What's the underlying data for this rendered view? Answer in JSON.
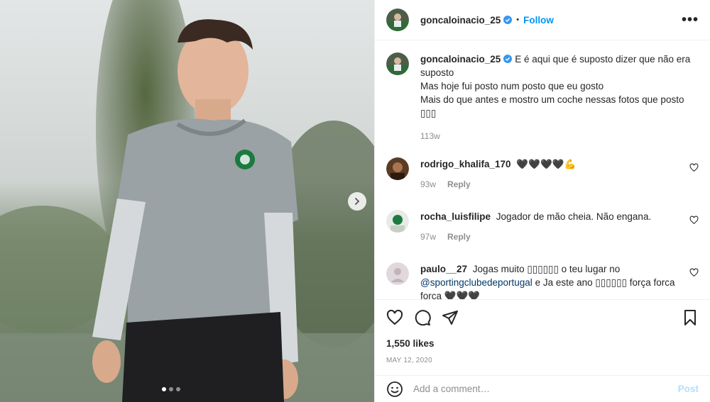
{
  "header": {
    "username": "goncaloinacio_25",
    "separator": "•",
    "follow_label": "Follow",
    "more_label": "•••"
  },
  "caption": {
    "username": "goncaloinacio_25",
    "lines": [
      "E é aqui que é suposto dizer que não era suposto",
      "Mas hoje fui posto num posto que eu gosto",
      "Mais do que antes e mostro um coche nessas fotos que posto",
      "▯▯▯"
    ],
    "time": "113w"
  },
  "comments": [
    {
      "username": "rodrigo_khalifa_170",
      "text": "🖤🖤🖤🖤💪",
      "time": "93w",
      "reply_label": "Reply"
    },
    {
      "username": "rocha_luisfilipe",
      "text": "Jogador de mão cheia. Não engana.",
      "time": "97w",
      "reply_label": "Reply"
    },
    {
      "username": "paulo__27",
      "text_a": "Jogas muito ▯▯▯▯▯▯ o teu lugar no",
      "mention": "@sportingclubedeportugal",
      "text_b": "e Ja este ano ▯▯▯▯▯▯ força forca forca 🖤🖤🖤"
    }
  ],
  "likes": "1,550 likes",
  "date": "MAY 12, 2020",
  "add_comment": {
    "placeholder": "Add a comment…",
    "post_label": "Post"
  },
  "carousel": {
    "count": 3,
    "active": 1
  },
  "colors": {
    "accent": "#0095f6",
    "post_disabled": "#b2dffc",
    "muted": "#8e8e8e",
    "text": "#262626"
  }
}
